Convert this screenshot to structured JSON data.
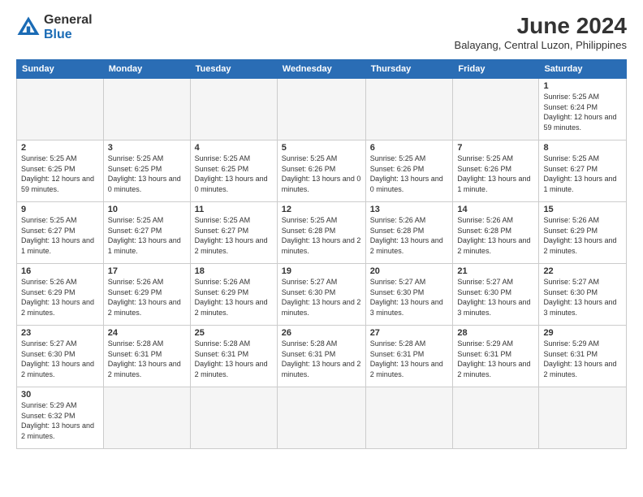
{
  "header": {
    "logo_general": "General",
    "logo_blue": "Blue",
    "month_year": "June 2024",
    "location": "Balayang, Central Luzon, Philippines"
  },
  "weekdays": [
    "Sunday",
    "Monday",
    "Tuesday",
    "Wednesday",
    "Thursday",
    "Friday",
    "Saturday"
  ],
  "weeks": [
    [
      {
        "day": "",
        "info": ""
      },
      {
        "day": "",
        "info": ""
      },
      {
        "day": "",
        "info": ""
      },
      {
        "day": "",
        "info": ""
      },
      {
        "day": "",
        "info": ""
      },
      {
        "day": "",
        "info": ""
      },
      {
        "day": "1",
        "info": "Sunrise: 5:25 AM\nSunset: 6:24 PM\nDaylight: 12 hours\nand 59 minutes."
      }
    ],
    [
      {
        "day": "2",
        "info": "Sunrise: 5:25 AM\nSunset: 6:25 PM\nDaylight: 12 hours\nand 59 minutes."
      },
      {
        "day": "3",
        "info": "Sunrise: 5:25 AM\nSunset: 6:25 PM\nDaylight: 13 hours\nand 0 minutes."
      },
      {
        "day": "4",
        "info": "Sunrise: 5:25 AM\nSunset: 6:25 PM\nDaylight: 13 hours\nand 0 minutes."
      },
      {
        "day": "5",
        "info": "Sunrise: 5:25 AM\nSunset: 6:26 PM\nDaylight: 13 hours\nand 0 minutes."
      },
      {
        "day": "6",
        "info": "Sunrise: 5:25 AM\nSunset: 6:26 PM\nDaylight: 13 hours\nand 0 minutes."
      },
      {
        "day": "7",
        "info": "Sunrise: 5:25 AM\nSunset: 6:26 PM\nDaylight: 13 hours\nand 1 minute."
      },
      {
        "day": "8",
        "info": "Sunrise: 5:25 AM\nSunset: 6:27 PM\nDaylight: 13 hours\nand 1 minute."
      }
    ],
    [
      {
        "day": "9",
        "info": "Sunrise: 5:25 AM\nSunset: 6:27 PM\nDaylight: 13 hours\nand 1 minute."
      },
      {
        "day": "10",
        "info": "Sunrise: 5:25 AM\nSunset: 6:27 PM\nDaylight: 13 hours\nand 1 minute."
      },
      {
        "day": "11",
        "info": "Sunrise: 5:25 AM\nSunset: 6:27 PM\nDaylight: 13 hours\nand 2 minutes."
      },
      {
        "day": "12",
        "info": "Sunrise: 5:25 AM\nSunset: 6:28 PM\nDaylight: 13 hours\nand 2 minutes."
      },
      {
        "day": "13",
        "info": "Sunrise: 5:26 AM\nSunset: 6:28 PM\nDaylight: 13 hours\nand 2 minutes."
      },
      {
        "day": "14",
        "info": "Sunrise: 5:26 AM\nSunset: 6:28 PM\nDaylight: 13 hours\nand 2 minutes."
      },
      {
        "day": "15",
        "info": "Sunrise: 5:26 AM\nSunset: 6:29 PM\nDaylight: 13 hours\nand 2 minutes."
      }
    ],
    [
      {
        "day": "16",
        "info": "Sunrise: 5:26 AM\nSunset: 6:29 PM\nDaylight: 13 hours\nand 2 minutes."
      },
      {
        "day": "17",
        "info": "Sunrise: 5:26 AM\nSunset: 6:29 PM\nDaylight: 13 hours\nand 2 minutes."
      },
      {
        "day": "18",
        "info": "Sunrise: 5:26 AM\nSunset: 6:29 PM\nDaylight: 13 hours\nand 2 minutes."
      },
      {
        "day": "19",
        "info": "Sunrise: 5:27 AM\nSunset: 6:30 PM\nDaylight: 13 hours\nand 2 minutes."
      },
      {
        "day": "20",
        "info": "Sunrise: 5:27 AM\nSunset: 6:30 PM\nDaylight: 13 hours\nand 3 minutes."
      },
      {
        "day": "21",
        "info": "Sunrise: 5:27 AM\nSunset: 6:30 PM\nDaylight: 13 hours\nand 3 minutes."
      },
      {
        "day": "22",
        "info": "Sunrise: 5:27 AM\nSunset: 6:30 PM\nDaylight: 13 hours\nand 3 minutes."
      }
    ],
    [
      {
        "day": "23",
        "info": "Sunrise: 5:27 AM\nSunset: 6:30 PM\nDaylight: 13 hours\nand 2 minutes."
      },
      {
        "day": "24",
        "info": "Sunrise: 5:28 AM\nSunset: 6:31 PM\nDaylight: 13 hours\nand 2 minutes."
      },
      {
        "day": "25",
        "info": "Sunrise: 5:28 AM\nSunset: 6:31 PM\nDaylight: 13 hours\nand 2 minutes."
      },
      {
        "day": "26",
        "info": "Sunrise: 5:28 AM\nSunset: 6:31 PM\nDaylight: 13 hours\nand 2 minutes."
      },
      {
        "day": "27",
        "info": "Sunrise: 5:28 AM\nSunset: 6:31 PM\nDaylight: 13 hours\nand 2 minutes."
      },
      {
        "day": "28",
        "info": "Sunrise: 5:29 AM\nSunset: 6:31 PM\nDaylight: 13 hours\nand 2 minutes."
      },
      {
        "day": "29",
        "info": "Sunrise: 5:29 AM\nSunset: 6:31 PM\nDaylight: 13 hours\nand 2 minutes."
      }
    ],
    [
      {
        "day": "30",
        "info": "Sunrise: 5:29 AM\nSunset: 6:32 PM\nDaylight: 13 hours\nand 2 minutes."
      },
      {
        "day": "",
        "info": ""
      },
      {
        "day": "",
        "info": ""
      },
      {
        "day": "",
        "info": ""
      },
      {
        "day": "",
        "info": ""
      },
      {
        "day": "",
        "info": ""
      },
      {
        "day": "",
        "info": ""
      }
    ]
  ]
}
